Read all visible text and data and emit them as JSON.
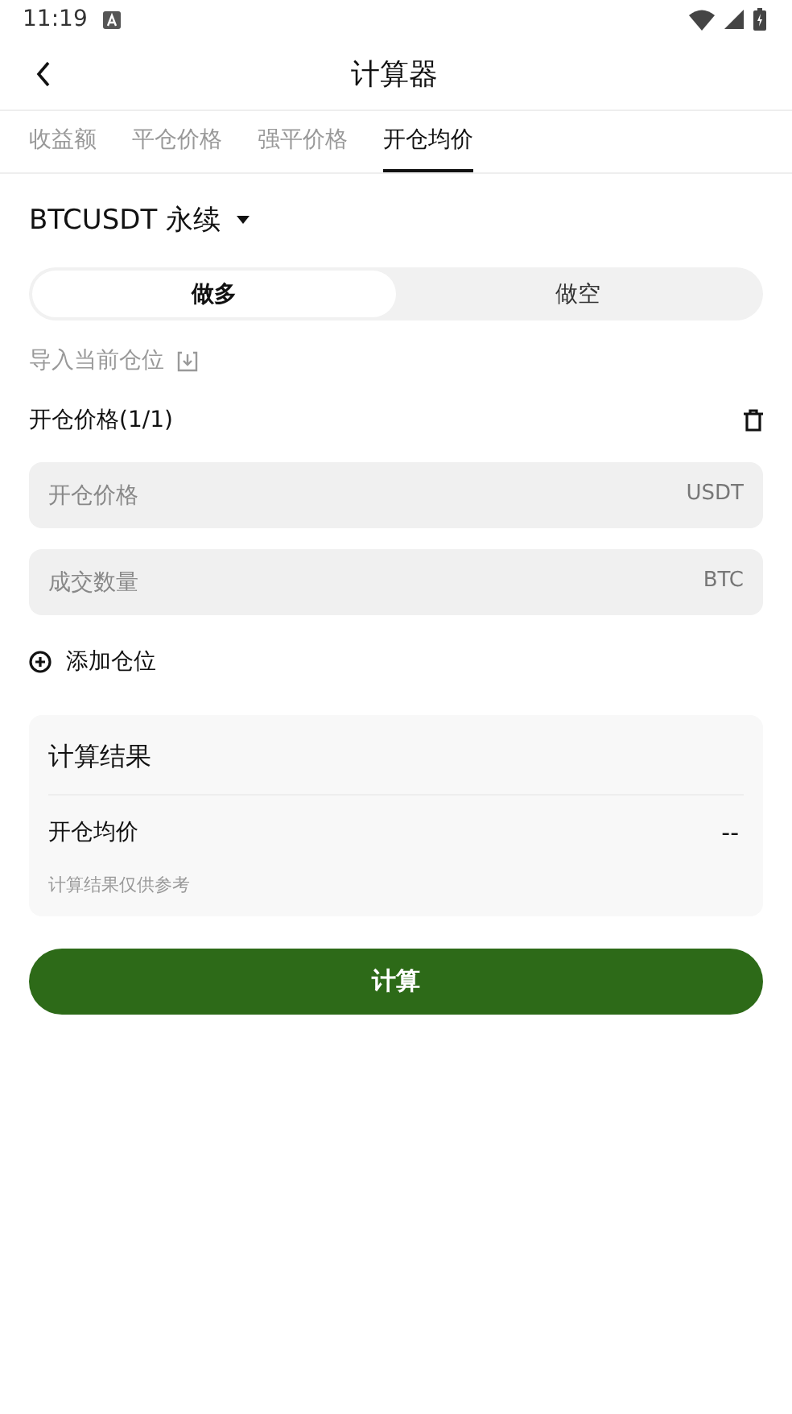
{
  "status_bar": {
    "time": "11:19"
  },
  "app_bar": {
    "title": "计算器"
  },
  "tabs": [
    {
      "label": "收益额",
      "selected": false
    },
    {
      "label": "平仓价格",
      "selected": false
    },
    {
      "label": "强平价格",
      "selected": false
    },
    {
      "label": "开仓均价",
      "selected": true
    }
  ],
  "symbol": {
    "label": "BTCUSDT 永续"
  },
  "direction": [
    {
      "label": "做多",
      "selected": true
    },
    {
      "label": "做空",
      "selected": false
    }
  ],
  "import_link": "导入当前仓位",
  "position": {
    "title": "开仓价格(1/1)",
    "fields": [
      {
        "placeholder": "开仓价格",
        "unit": "USDT"
      },
      {
        "placeholder": "成交数量",
        "unit": "BTC"
      }
    ]
  },
  "add_position": "添加仓位",
  "result": {
    "title": "计算结果",
    "rows": [
      {
        "label": "开仓均价",
        "value": "--"
      }
    ],
    "note": "计算结果仅供参考"
  },
  "calculate_button": "计算"
}
